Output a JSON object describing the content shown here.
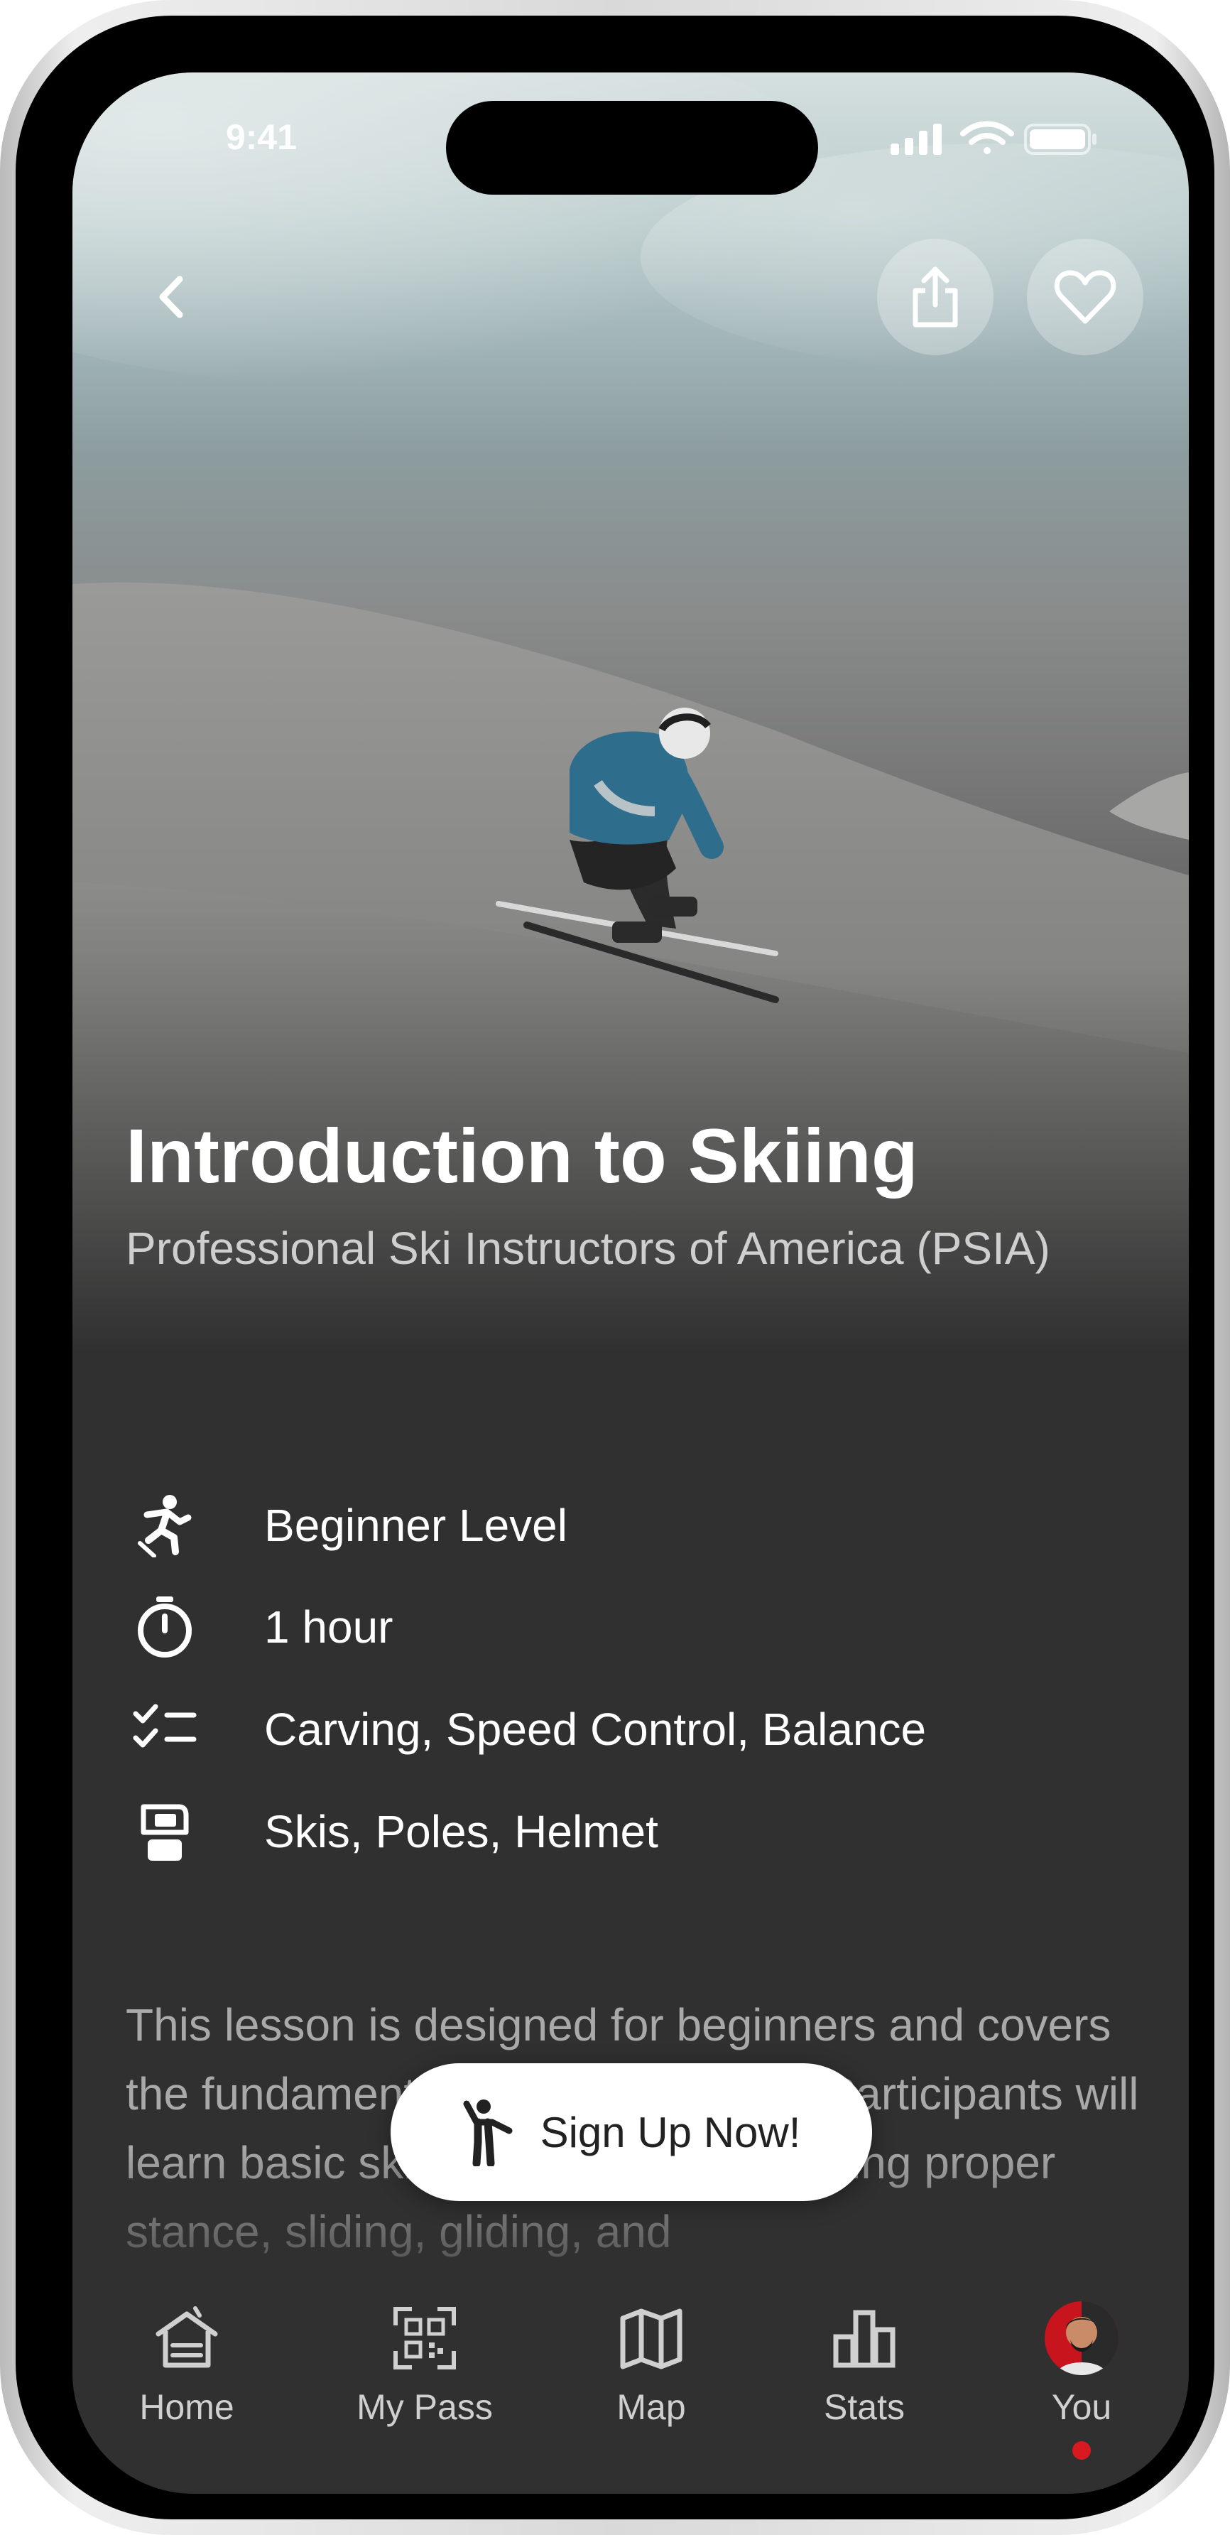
{
  "status_bar": {
    "time": "9:41"
  },
  "hero": {
    "back_icon": "chevron-left-icon",
    "share_icon": "share-icon",
    "favorite_icon": "heart-icon"
  },
  "lesson": {
    "title": "Introduction to Skiing",
    "provider": "Professional Ski Instructors of America (PSIA)",
    "details": [
      {
        "icon": "skier-icon",
        "text": "Beginner Level"
      },
      {
        "icon": "stopwatch-icon",
        "text": "1 hour"
      },
      {
        "icon": "checklist-icon",
        "text": "Carving, Speed Control, Balance"
      },
      {
        "icon": "ski-gear-icon",
        "text": "Skis, Poles, Helmet"
      }
    ],
    "description": "This lesson is designed for beginners and covers the fundamental aspects of skiing. Participants will learn basic skiing techniques, including proper stance, sliding, gliding, and"
  },
  "cta": {
    "label": "Sign Up Now!",
    "icon": "person-signup-icon"
  },
  "tab_bar": {
    "items": [
      {
        "label": "Home",
        "icon": "home-icon"
      },
      {
        "label": "My Pass",
        "icon": "qr-code-icon"
      },
      {
        "label": "Map",
        "icon": "map-icon"
      },
      {
        "label": "Stats",
        "icon": "bar-chart-icon"
      },
      {
        "label": "You",
        "icon": "avatar",
        "active": true
      }
    ]
  },
  "colors": {
    "background": "#303030",
    "text_primary": "#ffffff",
    "text_secondary": "#cfcfcf",
    "accent_red": "#d71920",
    "cta_background": "#ffffff"
  }
}
